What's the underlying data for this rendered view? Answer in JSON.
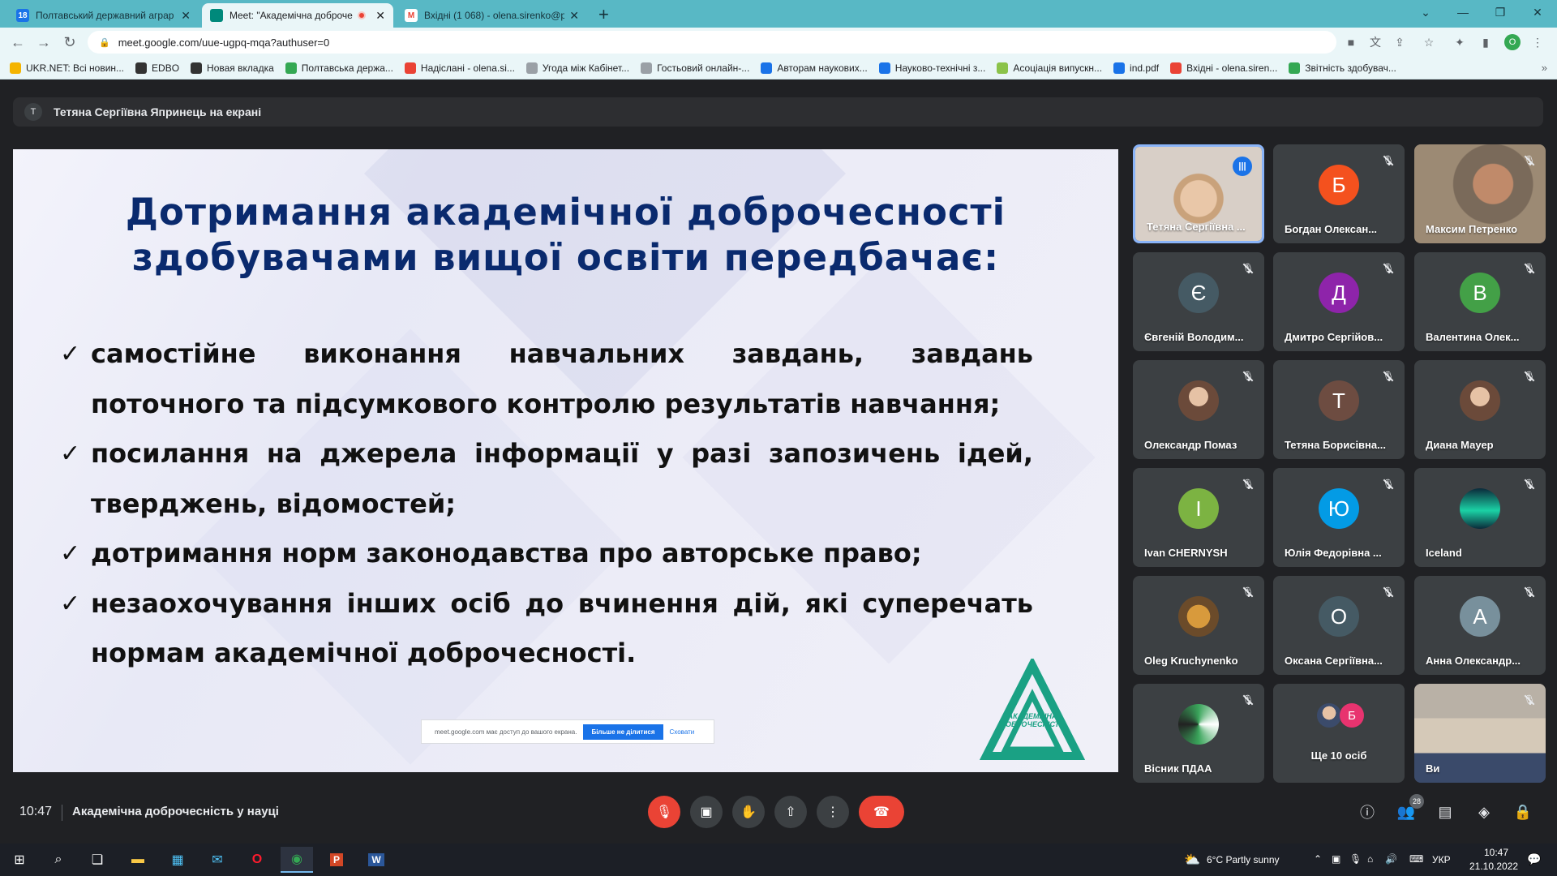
{
  "browser": {
    "tabs": [
      {
        "title": "Полтавський державний аграр",
        "active": false,
        "favicon_color": "#1a73e8",
        "favicon_text": "18"
      },
      {
        "title": "Meet: \"Академічна доброче",
        "active": true,
        "favicon_color": "#00897b",
        "favicon_text": "",
        "recording": true
      },
      {
        "title": "Вхідні (1 068) - olena.sirenko@p",
        "active": false,
        "favicon_color": "#ea4335",
        "favicon_text": "M"
      }
    ],
    "url": "meet.google.com/uue-ugpq-mqa?authuser=0",
    "profile_initial": "O",
    "bookmarks": [
      {
        "label": "UKR.NET: Всі новин...",
        "color": "#f4b400"
      },
      {
        "label": "EDBO",
        "color": "#333333"
      },
      {
        "label": "Новая вкладка",
        "color": "#333333"
      },
      {
        "label": "Полтавська держа...",
        "color": "#34a853"
      },
      {
        "label": "Надіслані - olena.si...",
        "color": "#ea4335"
      },
      {
        "label": "Угода між Кабінет...",
        "color": "#9aa0a6"
      },
      {
        "label": "Гостьовий онлайн-...",
        "color": "#9aa0a6"
      },
      {
        "label": "Авторам наукових...",
        "color": "#1a73e8"
      },
      {
        "label": "Науково-технічні з...",
        "color": "#1a73e8"
      },
      {
        "label": "Асоціація випускн...",
        "color": "#8bc34a"
      },
      {
        "label": "ind.pdf",
        "color": "#1a73e8"
      },
      {
        "label": "Вхідні - olena.siren...",
        "color": "#ea4335"
      },
      {
        "label": "Звітність здобувач...",
        "color": "#34a853"
      }
    ]
  },
  "meet": {
    "presenter_bar": "Тетяна Сергіївна Япринець на екрані",
    "presenter_initial": "T",
    "slide": {
      "title_line1": "Дотримання академічної доброчесності",
      "title_line2": "здобувачами вищої освіти передбачає:",
      "bullets": [
        "самостійне виконання навчальних завдань, завдань поточного та підсумкового контролю результатів навчання;",
        "посилання на джерела інформації у разі запозичень ідей, тверджень, відомостей;",
        "дотримання норм законодавства про авторське право;",
        "незаохочування інших осіб до вчинення дій, які суперечать нормам академічної доброчесності."
      ],
      "checkmark": "✓",
      "logo_text": "АКАДЕМІЧНА ДОБРОЧЕСНІСТЬ",
      "share_notice": {
        "text": "meet.google.com має доступ до вашого екрана.",
        "primary": "Більше не ділитися",
        "secondary": "Сховати"
      }
    },
    "participants": [
      {
        "name": "Тетяна Сергіївна ...",
        "type": "video",
        "speaking": true
      },
      {
        "name": "Богдан Олексан...",
        "initial": "Б",
        "color": "#f4511e"
      },
      {
        "name": "Максим Петренко",
        "type": "video"
      },
      {
        "name": "Євгеній Володим...",
        "initial": "Є",
        "color": "#455a64"
      },
      {
        "name": "Дмитро Сергійов...",
        "initial": "Д",
        "color": "#8e24aa"
      },
      {
        "name": "Валентина Олек...",
        "initial": "В",
        "color": "#43a047"
      },
      {
        "name": "Олександр Помаз",
        "type": "photo"
      },
      {
        "name": "Тетяна Борисівна...",
        "initial": "Т",
        "color": "#6d4c41"
      },
      {
        "name": "Диана Мауер",
        "type": "photo"
      },
      {
        "name": "Ivan CHERNYSH",
        "initial": "I",
        "color": "#7cb342"
      },
      {
        "name": "Юлія Федорівна ...",
        "initial": "Ю",
        "color": "#039be5"
      },
      {
        "name": "Iceland",
        "type": "photo"
      },
      {
        "name": "Oleg Kruchynenko",
        "type": "photo"
      },
      {
        "name": "Оксана Сергіївна...",
        "initial": "О",
        "color": "#455a64"
      },
      {
        "name": "Анна Олександр...",
        "initial": "А",
        "color": "#78909c"
      },
      {
        "name": "Вісник ПДАА",
        "type": "photo"
      },
      {
        "name": "Ще 10 осіб",
        "type": "more",
        "initial": "Б"
      },
      {
        "name": "Ви",
        "type": "video"
      }
    ],
    "bottom": {
      "time": "10:47",
      "meeting_title": "Академічна доброчесність у науці",
      "participant_count": "28"
    }
  },
  "taskbar": {
    "weather": "6°C  Partly sunny",
    "lang": "УКР",
    "time": "10:47",
    "date": "21.10.2022"
  }
}
